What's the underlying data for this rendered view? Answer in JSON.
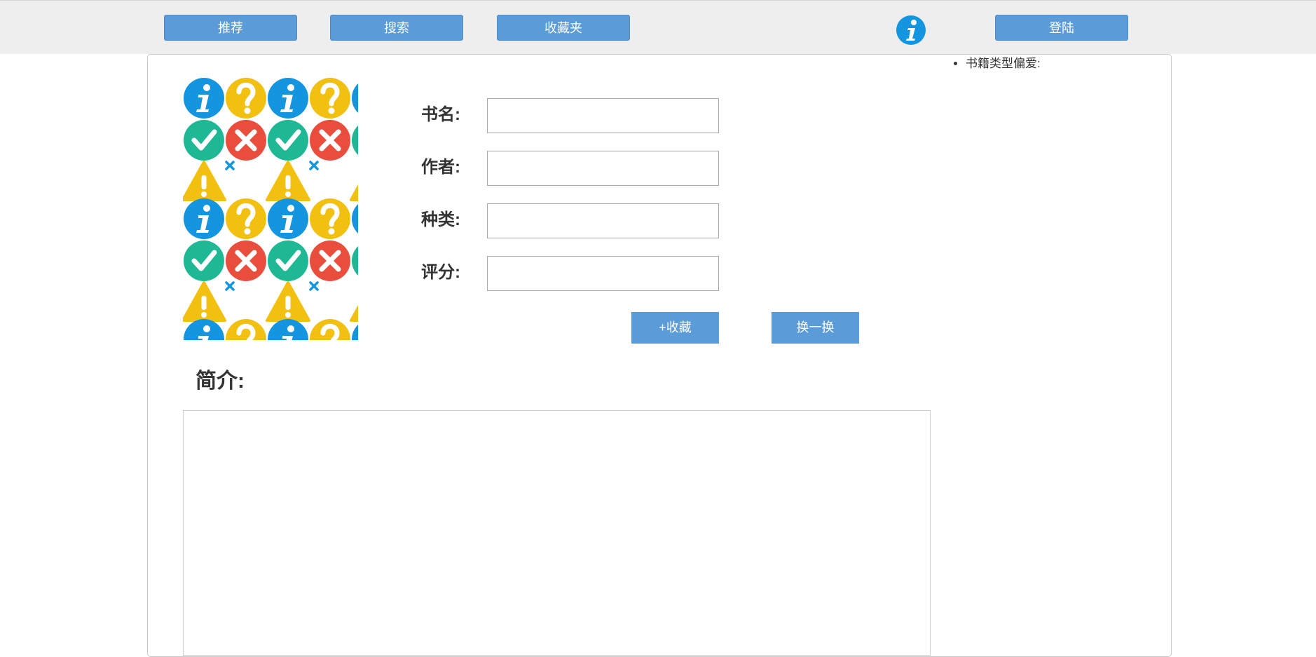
{
  "nav": {
    "recommend": "推荐",
    "search": "搜索",
    "favorites": "收藏夹",
    "login": "登陆"
  },
  "sidebar": {
    "preference_label": "书籍类型偏爱:"
  },
  "book": {
    "title_label": "书名:",
    "author_label": "作者:",
    "category_label": "种类:",
    "rating_label": "评分:",
    "title_value": "",
    "author_value": "",
    "category_value": "",
    "rating_value": ""
  },
  "actions": {
    "add_favorite": "+收藏",
    "shuffle": "换一换"
  },
  "intro": {
    "title": "简介:",
    "text": ""
  },
  "colors": {
    "button_blue": "#5b9bd8",
    "topbar_bg": "#eeeeee",
    "icon_blue": "#1495e0",
    "icon_yellow": "#f2c010",
    "icon_green": "#1fb895",
    "icon_red": "#e94e3c"
  },
  "icons": {
    "logo": "info-icon",
    "cover_pattern": [
      "info-icon",
      "question-icon",
      "check-icon",
      "cross-icon",
      "warning-icon"
    ]
  }
}
